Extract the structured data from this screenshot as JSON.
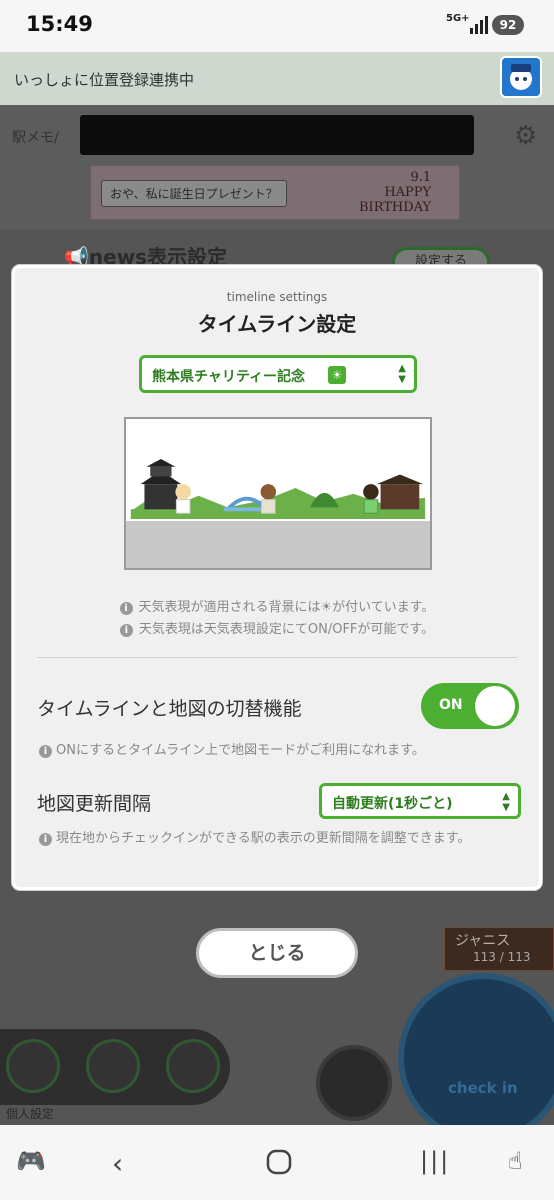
{
  "status_bar": {
    "time": "15:49",
    "network": "5G+",
    "battery": "92"
  },
  "location_banner": {
    "text": "いっしょに位置登録連携中"
  },
  "background_app": {
    "app_label": "駅メモ/",
    "banner_text": "おや、私に誕生日プレゼント？",
    "banner_date": "9.1",
    "banner_bday_line1": "HAPPY",
    "banner_bday_line2": "BIRTHDAY",
    "news_label": "news表示設定",
    "setting_button": "設定する",
    "character_name": "ジャニス",
    "character_count": "113 / 113",
    "checkin_label": "check in",
    "personal_settings": "個人設定"
  },
  "modal": {
    "subtitle": "timeline settings",
    "title": "タイムライン設定",
    "background_select": "熊本県チャリティー記念",
    "note1": "天気表現が適用される背景には☀が付いています。",
    "note2": "天気表現は天気表現設定にてON/OFFが可能です。",
    "toggle_label": "タイムラインと地図の切替機能",
    "toggle_value": "ON",
    "toggle_hint": "ONにするとタイムライン上で地図モードがご利用になれます。",
    "interval_label": "地図更新間隔",
    "interval_select": "自動更新(1秒ごと)",
    "interval_hint": "現在地からチェックインができる駅の表示の更新間隔を調整できます。"
  },
  "close_button": "とじる",
  "colors": {
    "accent_green": "#4caf32",
    "dark_green": "#2e7d1f"
  }
}
